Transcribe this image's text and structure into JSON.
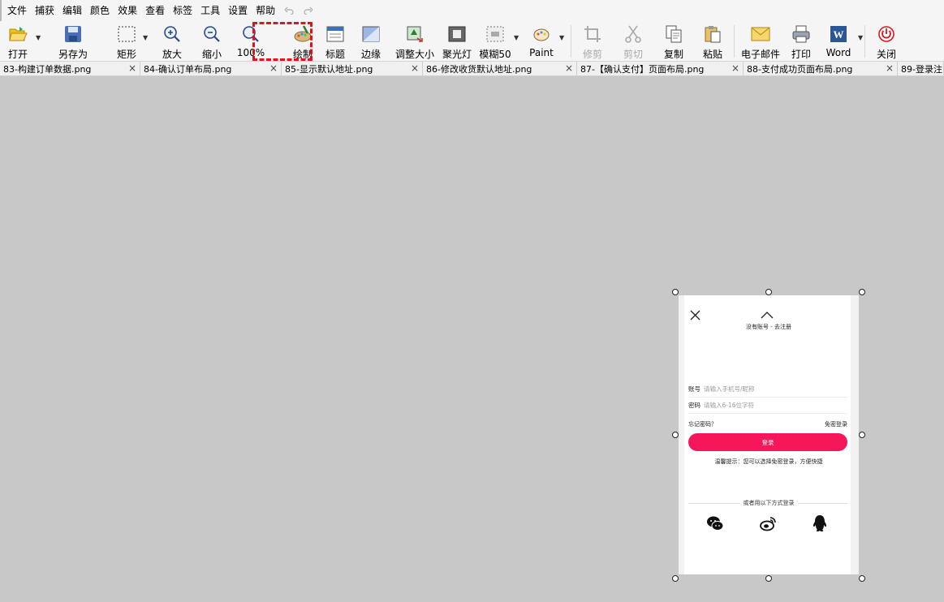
{
  "menu": [
    "文件",
    "捕获",
    "编辑",
    "颜色",
    "效果",
    "查看",
    "标签",
    "工具",
    "设置",
    "帮助"
  ],
  "toolbar": {
    "open": "打开",
    "save_as": "另存为",
    "rectangle": "矩形",
    "zoom_in": "放大",
    "zoom_out": "缩小",
    "zoom_100": "100%",
    "draw": "绘制",
    "title": "标题",
    "edge": "边缘",
    "resize": "调整大小",
    "spotlight": "聚光灯",
    "blur": "模糊50",
    "paint": "Paint",
    "crop": "修剪",
    "cut": "剪切",
    "copy": "复制",
    "paste": "粘贴",
    "email": "电子邮件",
    "print": "打印",
    "word": "Word",
    "close": "关闭"
  },
  "tabs": [
    "83-构建订单数据.png",
    "84-确认订单布局.png",
    "85-显示默认地址.png",
    "86-修改收货默认地址.png",
    "87-【确认支付】页面布局.png",
    "88-支付成功页面布局.png",
    "89-登录注"
  ],
  "mobile": {
    "register_link": "没有账号 - 去注册",
    "account_label": "账号",
    "account_placeholder": "请输入手机号/昵称",
    "password_label": "密码",
    "password_placeholder": "请输入6-16位字符",
    "forgot": "忘记密码？",
    "password_free": "免密登录",
    "login_button": "登录",
    "tip": "温馨提示：您可以选择免密登录，方便快捷",
    "other_methods": "或者用以下方式登录"
  },
  "colors": {
    "accent": "#f51759",
    "highlight": "#e0141b"
  }
}
